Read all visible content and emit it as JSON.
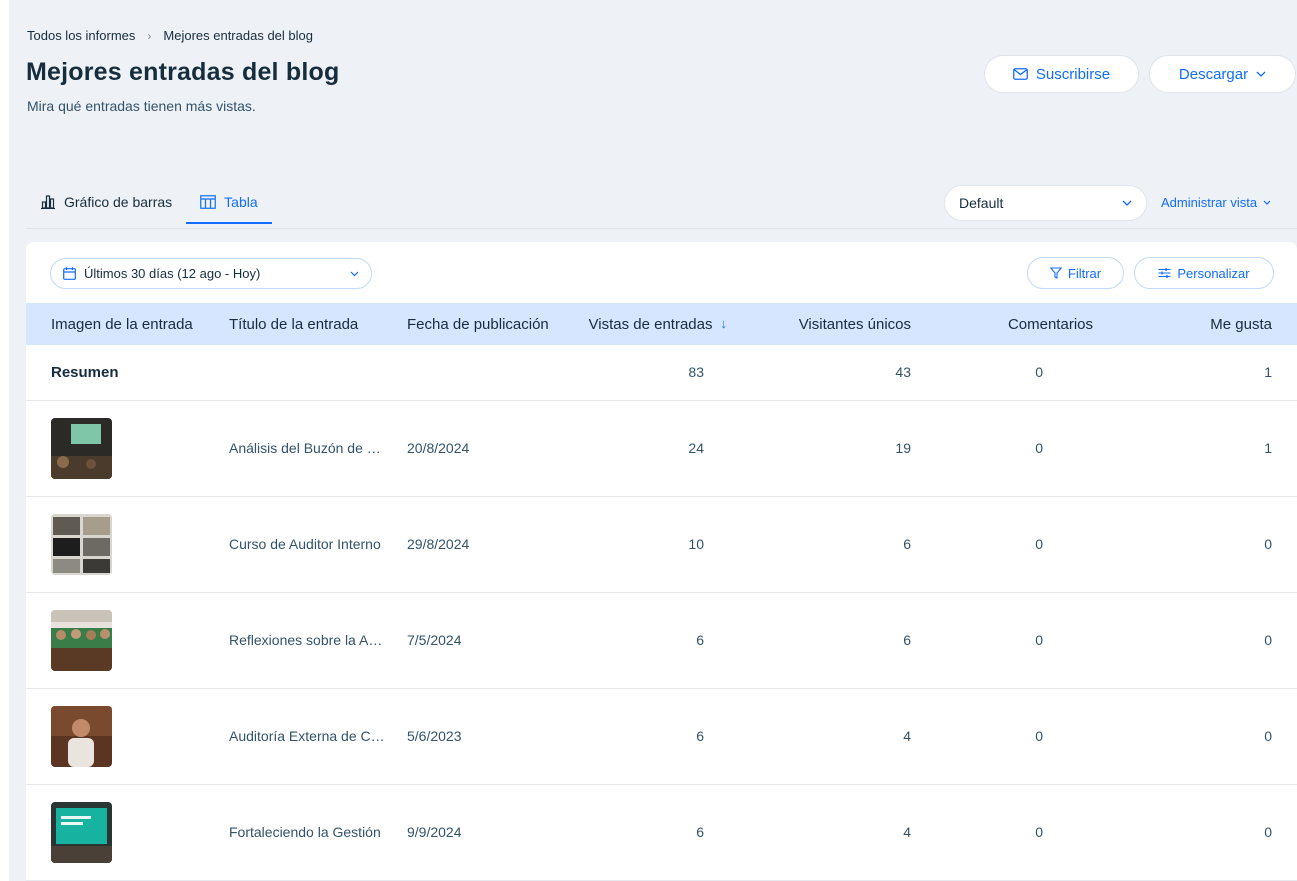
{
  "breadcrumb": {
    "parent": "Todos los informes",
    "separator": "›",
    "current": "Mejores entradas del blog"
  },
  "header": {
    "title": "Mejores entradas del blog",
    "subtitle": "Mira qué entradas tienen más vistas.",
    "subscribe_label": "Suscribirse",
    "download_label": "Descargar"
  },
  "tabs": [
    {
      "label": "Gráfico de barras",
      "icon": "bar-chart-icon",
      "active": false
    },
    {
      "label": "Tabla",
      "icon": "table-icon",
      "active": true
    }
  ],
  "view": {
    "selected": "Default",
    "manage_label": "Administrar vista"
  },
  "toolbar": {
    "date_range": "Últimos 30 días (12 ago - Hoy)",
    "filter_label": "Filtrar",
    "customize_label": "Personalizar"
  },
  "table": {
    "columns": [
      "Imagen de la entrada",
      "Título de la entrada",
      "Fecha de publicación",
      "Vistas de entradas",
      "Visitantes únicos",
      "Comentarios",
      "Me gusta"
    ],
    "summary": {
      "label": "Resumen",
      "views": "83",
      "unique": "43",
      "comments": "0",
      "likes": "1"
    },
    "rows": [
      {
        "title": "Análisis del Buzón de Quejas",
        "date": "20/8/2024",
        "views": "24",
        "unique": "19",
        "comments": "0",
        "likes": "1"
      },
      {
        "title": "Curso de Auditor Interno",
        "date": "29/8/2024",
        "views": "10",
        "unique": "6",
        "comments": "0",
        "likes": "0"
      },
      {
        "title": "Reflexiones sobre la Auditoría",
        "date": "7/5/2024",
        "views": "6",
        "unique": "6",
        "comments": "0",
        "likes": "0"
      },
      {
        "title": "Auditoría Externa de Calidad",
        "date": "5/6/2023",
        "views": "6",
        "unique": "4",
        "comments": "0",
        "likes": "0"
      },
      {
        "title": "Fortaleciendo la Gestión",
        "date": "9/9/2024",
        "views": "6",
        "unique": "4",
        "comments": "0",
        "likes": "0"
      }
    ]
  },
  "colors": {
    "accent": "#116dff",
    "header_bg": "#d6e6fe",
    "page_bg": "#eef1f6",
    "text": "#162d3d"
  }
}
